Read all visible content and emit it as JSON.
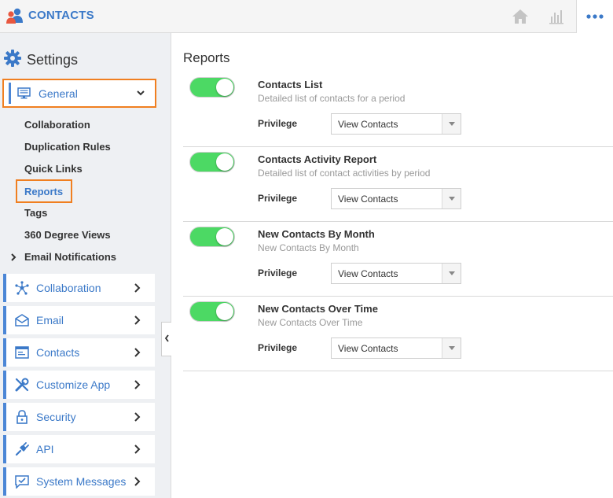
{
  "app": {
    "title": "CONTACTS"
  },
  "colors": {
    "accent": "#3b79c8",
    "highlight": "#f07f20",
    "toggle_on": "#4cd964"
  },
  "sidebar": {
    "settings_label": "Settings",
    "general": {
      "label": "General",
      "expanded": true
    },
    "sub_items": [
      "Collaboration",
      "Duplication Rules",
      "Quick Links",
      "Reports",
      "Tags",
      "360 Degree Views",
      "Email Notifications"
    ],
    "selected_sub_item": "Reports",
    "nav_items": [
      {
        "label": "Collaboration",
        "icon": "network-icon"
      },
      {
        "label": "Email",
        "icon": "envelope-icon"
      },
      {
        "label": "Contacts",
        "icon": "contact-card-icon"
      },
      {
        "label": "Customize App",
        "icon": "tools-icon"
      },
      {
        "label": "Security",
        "icon": "lock-icon"
      },
      {
        "label": "API",
        "icon": "plug-icon"
      },
      {
        "label": "System Messages",
        "icon": "message-check-icon"
      }
    ]
  },
  "main": {
    "title": "Reports",
    "privilege_label": "Privilege",
    "reports": [
      {
        "title": "Contacts List",
        "description": "Detailed list of contacts for a period",
        "enabled": true,
        "privilege": "View Contacts"
      },
      {
        "title": "Contacts Activity Report",
        "description": "Detailed list of contact activities by period",
        "enabled": true,
        "privilege": "View Contacts"
      },
      {
        "title": "New Contacts By Month",
        "description": "New Contacts By Month",
        "enabled": true,
        "privilege": "View Contacts"
      },
      {
        "title": "New Contacts Over Time",
        "description": "New Contacts Over Time",
        "enabled": true,
        "privilege": "View Contacts"
      }
    ]
  }
}
